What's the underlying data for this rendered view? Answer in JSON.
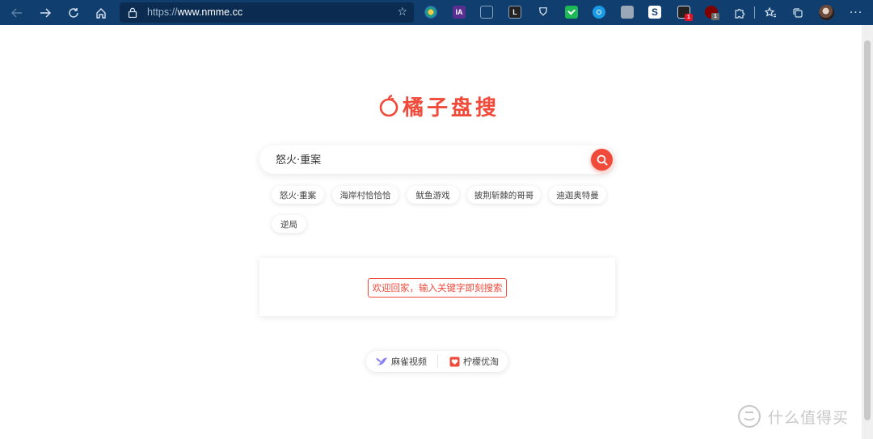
{
  "browser": {
    "url_protocol": "https://",
    "url_host": "www.nmme.cc",
    "extensions": [
      {
        "name": "colorful-circle-icon",
        "glyph": "",
        "color": "#1f9a8a"
      },
      {
        "name": "ia-extension-icon",
        "glyph": "IA",
        "color": "#5b2e91"
      },
      {
        "name": "pages-icon",
        "glyph": "",
        "color": "#6b7c93"
      },
      {
        "name": "lastpass-icon",
        "glyph": "L",
        "color": "#222222"
      },
      {
        "name": "shield-extension-icon",
        "glyph": "",
        "color": "#e7ebf0"
      },
      {
        "name": "green-extension-icon",
        "glyph": "",
        "color": "#1db954"
      },
      {
        "name": "blue-hex-icon",
        "glyph": "",
        "color": "#1a9be6"
      },
      {
        "name": "doc-extension-icon",
        "glyph": "",
        "color": "#9aa7b6"
      },
      {
        "name": "s-extension-icon",
        "glyph": "S",
        "color": "#ffffff"
      },
      {
        "name": "dark-extension-icon",
        "glyph": "",
        "color": "#222222"
      },
      {
        "name": "ublock-icon",
        "glyph": "",
        "color": "#800000"
      }
    ],
    "badges": {
      "ext10": "1",
      "ext11": "1"
    }
  },
  "logo": {
    "text": "橘子盘搜"
  },
  "search": {
    "value": "怒火·重案"
  },
  "chips": [
    "怒火·重案",
    "海岸村恰恰恰",
    "鱿鱼游戏",
    "披荆斩棘的哥哥",
    "迪迦奥特曼",
    "逆局"
  ],
  "notice": {
    "text": "欢迎回家，输入关键字即刻搜索"
  },
  "links": [
    {
      "label": "麻雀视频"
    },
    {
      "label": "柠檬优淘"
    }
  ],
  "watermark": {
    "text": "什么值得买"
  },
  "colors": {
    "accent": "#f04a3a",
    "toolbar": "#103f6f"
  }
}
